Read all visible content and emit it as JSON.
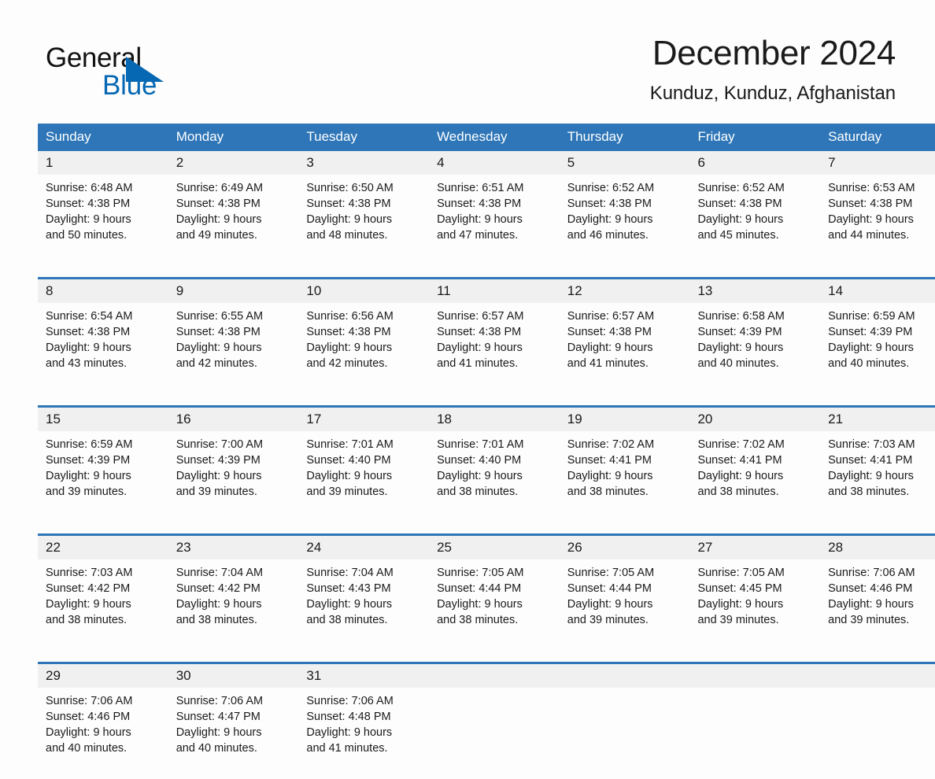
{
  "brand": {
    "name_part1": "General",
    "name_part2": "Blue",
    "triangle_icon": "triangle-logo-icon",
    "accent_color": "#0668b3"
  },
  "header": {
    "title": "December 2024",
    "location": "Kunduz, Kunduz, Afghanistan"
  },
  "theme": {
    "header_blue": "#2e76b8",
    "daynum_band": "#f0f0f0",
    "page_background": "#fdfdfd"
  },
  "calendar": {
    "weekday_headers": [
      "Sunday",
      "Monday",
      "Tuesday",
      "Wednesday",
      "Thursday",
      "Friday",
      "Saturday"
    ],
    "weeks": [
      [
        {
          "day": "1",
          "sunrise": "Sunrise: 6:48 AM",
          "sunset": "Sunset: 4:38 PM",
          "daylight_line1": "Daylight: 9 hours",
          "daylight_line2": "and 50 minutes."
        },
        {
          "day": "2",
          "sunrise": "Sunrise: 6:49 AM",
          "sunset": "Sunset: 4:38 PM",
          "daylight_line1": "Daylight: 9 hours",
          "daylight_line2": "and 49 minutes."
        },
        {
          "day": "3",
          "sunrise": "Sunrise: 6:50 AM",
          "sunset": "Sunset: 4:38 PM",
          "daylight_line1": "Daylight: 9 hours",
          "daylight_line2": "and 48 minutes."
        },
        {
          "day": "4",
          "sunrise": "Sunrise: 6:51 AM",
          "sunset": "Sunset: 4:38 PM",
          "daylight_line1": "Daylight: 9 hours",
          "daylight_line2": "and 47 minutes."
        },
        {
          "day": "5",
          "sunrise": "Sunrise: 6:52 AM",
          "sunset": "Sunset: 4:38 PM",
          "daylight_line1": "Daylight: 9 hours",
          "daylight_line2": "and 46 minutes."
        },
        {
          "day": "6",
          "sunrise": "Sunrise: 6:52 AM",
          "sunset": "Sunset: 4:38 PM",
          "daylight_line1": "Daylight: 9 hours",
          "daylight_line2": "and 45 minutes."
        },
        {
          "day": "7",
          "sunrise": "Sunrise: 6:53 AM",
          "sunset": "Sunset: 4:38 PM",
          "daylight_line1": "Daylight: 9 hours",
          "daylight_line2": "and 44 minutes."
        }
      ],
      [
        {
          "day": "8",
          "sunrise": "Sunrise: 6:54 AM",
          "sunset": "Sunset: 4:38 PM",
          "daylight_line1": "Daylight: 9 hours",
          "daylight_line2": "and 43 minutes."
        },
        {
          "day": "9",
          "sunrise": "Sunrise: 6:55 AM",
          "sunset": "Sunset: 4:38 PM",
          "daylight_line1": "Daylight: 9 hours",
          "daylight_line2": "and 42 minutes."
        },
        {
          "day": "10",
          "sunrise": "Sunrise: 6:56 AM",
          "sunset": "Sunset: 4:38 PM",
          "daylight_line1": "Daylight: 9 hours",
          "daylight_line2": "and 42 minutes."
        },
        {
          "day": "11",
          "sunrise": "Sunrise: 6:57 AM",
          "sunset": "Sunset: 4:38 PM",
          "daylight_line1": "Daylight: 9 hours",
          "daylight_line2": "and 41 minutes."
        },
        {
          "day": "12",
          "sunrise": "Sunrise: 6:57 AM",
          "sunset": "Sunset: 4:38 PM",
          "daylight_line1": "Daylight: 9 hours",
          "daylight_line2": "and 41 minutes."
        },
        {
          "day": "13",
          "sunrise": "Sunrise: 6:58 AM",
          "sunset": "Sunset: 4:39 PM",
          "daylight_line1": "Daylight: 9 hours",
          "daylight_line2": "and 40 minutes."
        },
        {
          "day": "14",
          "sunrise": "Sunrise: 6:59 AM",
          "sunset": "Sunset: 4:39 PM",
          "daylight_line1": "Daylight: 9 hours",
          "daylight_line2": "and 40 minutes."
        }
      ],
      [
        {
          "day": "15",
          "sunrise": "Sunrise: 6:59 AM",
          "sunset": "Sunset: 4:39 PM",
          "daylight_line1": "Daylight: 9 hours",
          "daylight_line2": "and 39 minutes."
        },
        {
          "day": "16",
          "sunrise": "Sunrise: 7:00 AM",
          "sunset": "Sunset: 4:39 PM",
          "daylight_line1": "Daylight: 9 hours",
          "daylight_line2": "and 39 minutes."
        },
        {
          "day": "17",
          "sunrise": "Sunrise: 7:01 AM",
          "sunset": "Sunset: 4:40 PM",
          "daylight_line1": "Daylight: 9 hours",
          "daylight_line2": "and 39 minutes."
        },
        {
          "day": "18",
          "sunrise": "Sunrise: 7:01 AM",
          "sunset": "Sunset: 4:40 PM",
          "daylight_line1": "Daylight: 9 hours",
          "daylight_line2": "and 38 minutes."
        },
        {
          "day": "19",
          "sunrise": "Sunrise: 7:02 AM",
          "sunset": "Sunset: 4:41 PM",
          "daylight_line1": "Daylight: 9 hours",
          "daylight_line2": "and 38 minutes."
        },
        {
          "day": "20",
          "sunrise": "Sunrise: 7:02 AM",
          "sunset": "Sunset: 4:41 PM",
          "daylight_line1": "Daylight: 9 hours",
          "daylight_line2": "and 38 minutes."
        },
        {
          "day": "21",
          "sunrise": "Sunrise: 7:03 AM",
          "sunset": "Sunset: 4:41 PM",
          "daylight_line1": "Daylight: 9 hours",
          "daylight_line2": "and 38 minutes."
        }
      ],
      [
        {
          "day": "22",
          "sunrise": "Sunrise: 7:03 AM",
          "sunset": "Sunset: 4:42 PM",
          "daylight_line1": "Daylight: 9 hours",
          "daylight_line2": "and 38 minutes."
        },
        {
          "day": "23",
          "sunrise": "Sunrise: 7:04 AM",
          "sunset": "Sunset: 4:42 PM",
          "daylight_line1": "Daylight: 9 hours",
          "daylight_line2": "and 38 minutes."
        },
        {
          "day": "24",
          "sunrise": "Sunrise: 7:04 AM",
          "sunset": "Sunset: 4:43 PM",
          "daylight_line1": "Daylight: 9 hours",
          "daylight_line2": "and 38 minutes."
        },
        {
          "day": "25",
          "sunrise": "Sunrise: 7:05 AM",
          "sunset": "Sunset: 4:44 PM",
          "daylight_line1": "Daylight: 9 hours",
          "daylight_line2": "and 38 minutes."
        },
        {
          "day": "26",
          "sunrise": "Sunrise: 7:05 AM",
          "sunset": "Sunset: 4:44 PM",
          "daylight_line1": "Daylight: 9 hours",
          "daylight_line2": "and 39 minutes."
        },
        {
          "day": "27",
          "sunrise": "Sunrise: 7:05 AM",
          "sunset": "Sunset: 4:45 PM",
          "daylight_line1": "Daylight: 9 hours",
          "daylight_line2": "and 39 minutes."
        },
        {
          "day": "28",
          "sunrise": "Sunrise: 7:06 AM",
          "sunset": "Sunset: 4:46 PM",
          "daylight_line1": "Daylight: 9 hours",
          "daylight_line2": "and 39 minutes."
        }
      ],
      [
        {
          "day": "29",
          "sunrise": "Sunrise: 7:06 AM",
          "sunset": "Sunset: 4:46 PM",
          "daylight_line1": "Daylight: 9 hours",
          "daylight_line2": "and 40 minutes."
        },
        {
          "day": "30",
          "sunrise": "Sunrise: 7:06 AM",
          "sunset": "Sunset: 4:47 PM",
          "daylight_line1": "Daylight: 9 hours",
          "daylight_line2": "and 40 minutes."
        },
        {
          "day": "31",
          "sunrise": "Sunrise: 7:06 AM",
          "sunset": "Sunset: 4:48 PM",
          "daylight_line1": "Daylight: 9 hours",
          "daylight_line2": "and 41 minutes."
        },
        {
          "day": "",
          "sunrise": "",
          "sunset": "",
          "daylight_line1": "",
          "daylight_line2": ""
        },
        {
          "day": "",
          "sunrise": "",
          "sunset": "",
          "daylight_line1": "",
          "daylight_line2": ""
        },
        {
          "day": "",
          "sunrise": "",
          "sunset": "",
          "daylight_line1": "",
          "daylight_line2": ""
        },
        {
          "day": "",
          "sunrise": "",
          "sunset": "",
          "daylight_line1": "",
          "daylight_line2": ""
        }
      ]
    ]
  }
}
